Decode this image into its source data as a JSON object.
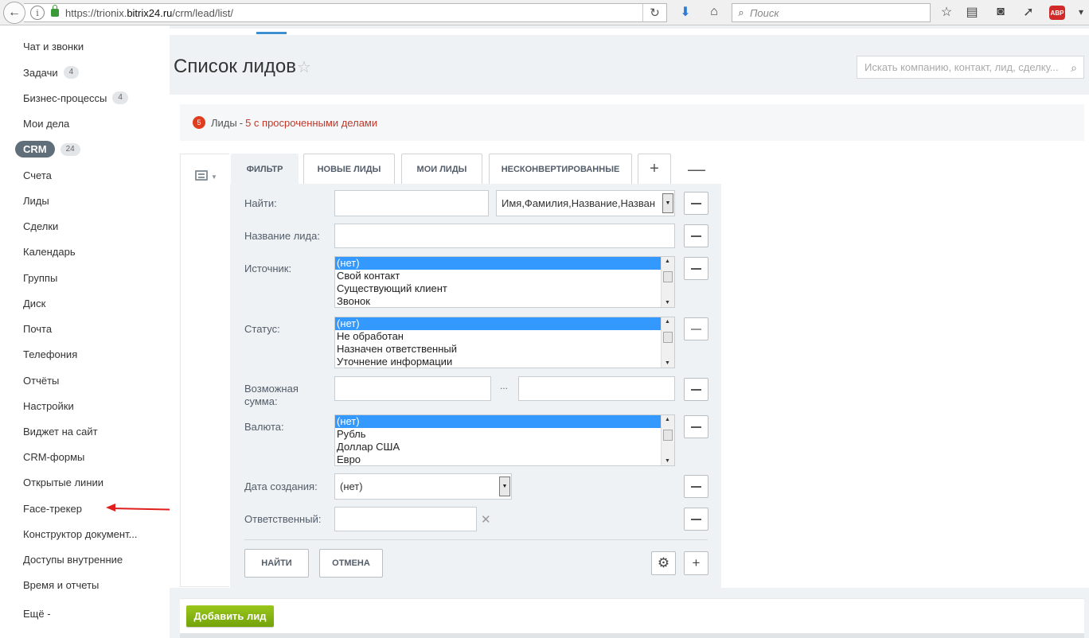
{
  "browser": {
    "url_prefix": "https://trionix.",
    "url_domain": "bitrix24.ru",
    "url_path": "/crm/lead/list/",
    "search_placeholder": "Поиск",
    "adblock_label": "ABP"
  },
  "left_menu": {
    "items": [
      {
        "label": "Чат и звонки"
      },
      {
        "label": "Задачи",
        "counter": "4"
      },
      {
        "label": "Бизнес-процессы",
        "counter": "4"
      },
      {
        "label": "Мои дела"
      },
      {
        "label": "CRM",
        "counter": "24"
      },
      {
        "label": "Счета"
      },
      {
        "label": "Лиды"
      },
      {
        "label": "Сделки"
      },
      {
        "label": "Календарь"
      },
      {
        "label": "Группы"
      },
      {
        "label": "Диск"
      },
      {
        "label": "Почта"
      },
      {
        "label": "Телефония"
      },
      {
        "label": "Отчёты"
      },
      {
        "label": "Настройки"
      },
      {
        "label": "Виджет на сайт"
      },
      {
        "label": "CRM-формы"
      },
      {
        "label": "Открытые линии"
      },
      {
        "label": "Face-трекер"
      },
      {
        "label": "Конструктор документ..."
      },
      {
        "label": "Доступы внутренние"
      },
      {
        "label": "Время и отчеты"
      },
      {
        "label": "Ещё -"
      }
    ]
  },
  "header": {
    "title": "Список лидов",
    "search_placeholder": "Искать компанию, контакт, лид, сделку..."
  },
  "notice": {
    "badge": "5",
    "label": "Лиды",
    "separator": "-",
    "link": "5 с просроченными делами"
  },
  "tabs": [
    {
      "label": "Фильтр",
      "active": true
    },
    {
      "label": "Новые лиды"
    },
    {
      "label": "Мои лиды"
    },
    {
      "label": "Несконвертированные"
    }
  ],
  "filter": {
    "find_label": "Найти:",
    "find_value": "",
    "find_scope": "Имя,Фамилия,Название,Назван",
    "lead_name_label": "Название лида:",
    "lead_name_value": "",
    "source_label": "Источник:",
    "source_options": [
      "(нет)",
      "Свой контакт",
      "Существующий клиент",
      "Звонок"
    ],
    "status_label": "Статус:",
    "status_options": [
      "(нет)",
      "Не обработан",
      "Назначен ответственный",
      "Уточнение информации"
    ],
    "amount_label": "Возможная сумма:",
    "amount_from": "",
    "amount_to": "",
    "amount_separator": "...",
    "currency_label": "Валюта:",
    "currency_options": [
      "(нет)",
      "Рубль",
      "Доллар США",
      "Евро"
    ],
    "created_label": "Дата создания:",
    "created_value": "(нет)",
    "responsible_label": "Ответственный:",
    "responsible_value": "",
    "find_button": "Найти",
    "cancel_button": "Отмена"
  },
  "actions": {
    "add_lead": "Добавить лид"
  },
  "colors": {
    "accent": "#3c8fd0",
    "add_button": "#7fb019",
    "alert": "#c0392b",
    "selected_option": "#3399ff"
  }
}
